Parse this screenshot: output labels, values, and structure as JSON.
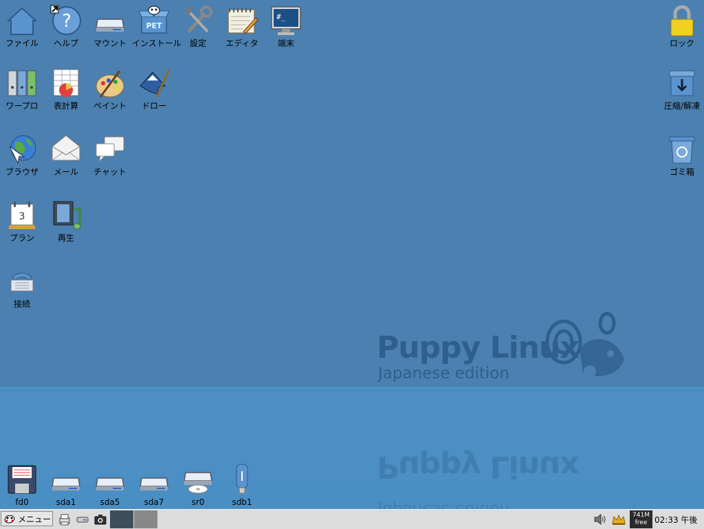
{
  "desktop": {
    "icons": [
      {
        "label": "ファイル",
        "icon": "home-icon"
      },
      {
        "label": "ヘルプ",
        "icon": "help-icon"
      },
      {
        "label": "マウント",
        "icon": "drive-icon"
      },
      {
        "label": "インストール",
        "icon": "pet-box-icon",
        "badge": "PET"
      },
      {
        "label": "設定",
        "icon": "tools-icon"
      },
      {
        "label": "エディタ",
        "icon": "notepad-icon"
      },
      {
        "label": "端末",
        "icon": "terminal-icon",
        "screen_text": "#_"
      },
      {
        "label": "ワープロ",
        "icon": "binders-icon"
      },
      {
        "label": "表計算",
        "icon": "spreadsheet-icon"
      },
      {
        "label": "ペイント",
        "icon": "palette-icon"
      },
      {
        "label": "ドロー",
        "icon": "inkscape-icon"
      },
      {
        "label": "ブラウザ",
        "icon": "globe-icon"
      },
      {
        "label": "メール",
        "icon": "envelope-icon"
      },
      {
        "label": "チャット",
        "icon": "chat-icon"
      },
      {
        "label": "プラン",
        "icon": "calendar-icon",
        "day": "3"
      },
      {
        "label": "再生",
        "icon": "media-icon"
      },
      {
        "label": "接続",
        "icon": "phone-icon"
      },
      {
        "label": "ロック",
        "icon": "lock-icon"
      },
      {
        "label": "圧縮/解凍",
        "icon": "archive-icon"
      },
      {
        "label": "ゴミ箱",
        "icon": "trash-icon"
      }
    ],
    "drives": [
      {
        "label": "fd0",
        "icon": "floppy-icon"
      },
      {
        "label": "sda1",
        "icon": "hdd-icon"
      },
      {
        "label": "sda5",
        "icon": "hdd-icon"
      },
      {
        "label": "sda7",
        "icon": "hdd-icon"
      },
      {
        "label": "sr0",
        "icon": "optical-drive-icon"
      },
      {
        "label": "sdb1",
        "icon": "usb-drive-icon"
      }
    ],
    "wallpaper": {
      "title": "Puppy Linux",
      "subtitle": "Japanese edition"
    }
  },
  "taskbar": {
    "menu_label": "メニュー",
    "free_line1": "741M",
    "free_line2": "free",
    "clock": "02:33 午後"
  },
  "colors": {
    "desktop": "#4b80b0",
    "taskbar": "#dcdcdc",
    "logo": "#2f5f8e"
  }
}
